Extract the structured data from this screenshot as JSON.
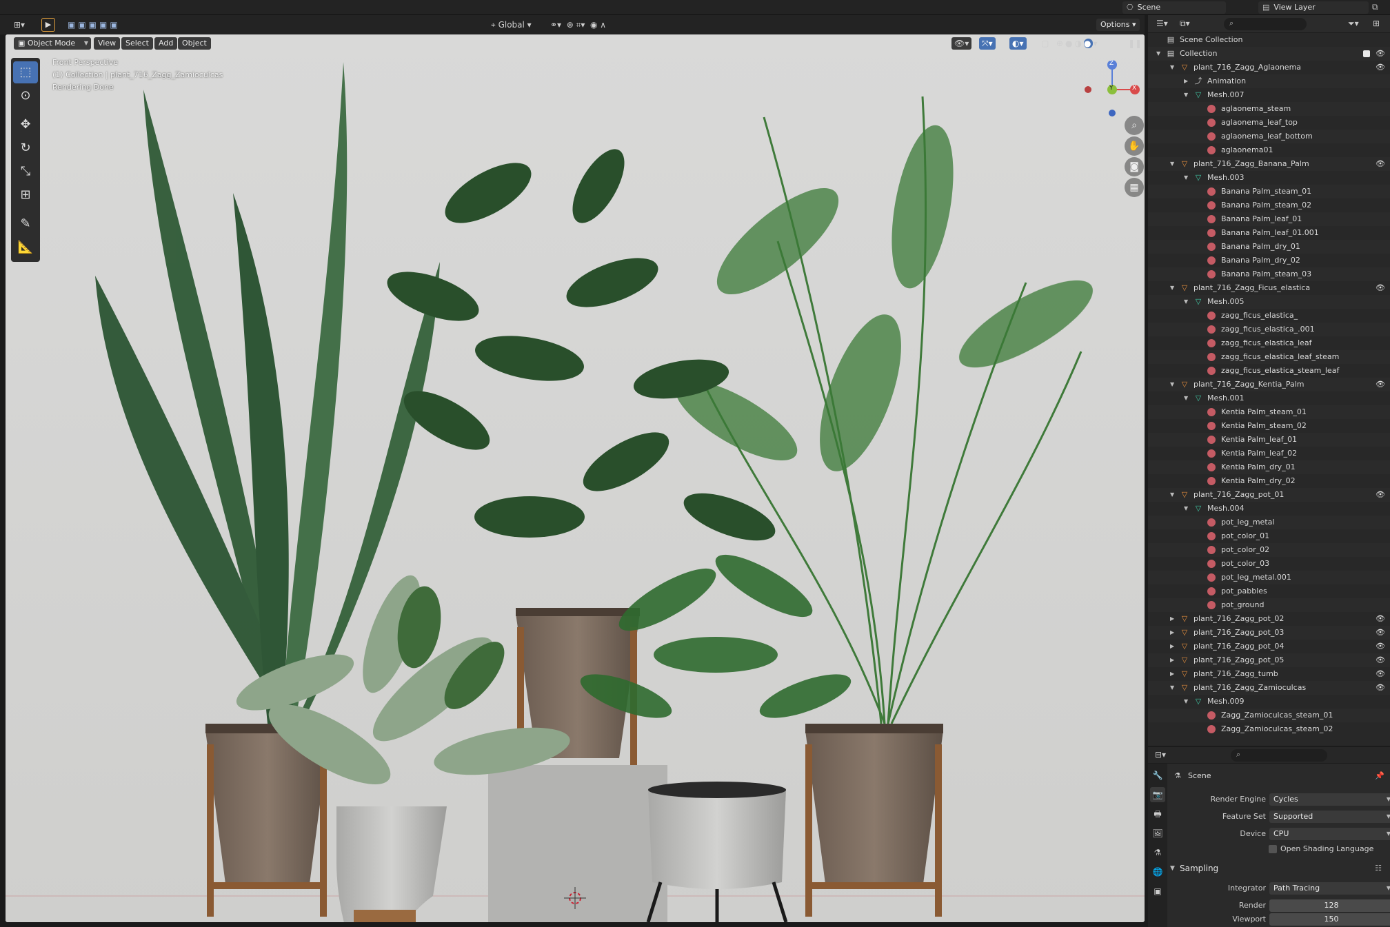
{
  "topbar": {
    "scene_label": "Scene",
    "view_layer_label": "View Layer"
  },
  "viewport_header": {
    "mode": "Object Mode",
    "menus": [
      "View",
      "Select",
      "Add",
      "Object"
    ],
    "transform_orientation": "Global",
    "options_label": "Options"
  },
  "viewport": {
    "overlay_lines": [
      "Front Perspective",
      "(1) Collection | plant_716_Zagg_Zamioculcas",
      "Rendering Done"
    ],
    "gizmo": {
      "z": "Z",
      "y": "Y",
      "x": "X"
    }
  },
  "outliner": {
    "rows": [
      {
        "label": "Scene Collection",
        "type": "scene",
        "depth": 0,
        "arrow": "",
        "eye": false
      },
      {
        "label": "Collection",
        "type": "collection",
        "depth": 0,
        "arrow": "▼",
        "eye": true
      },
      {
        "label": "plant_716_Zagg_Aglaonema",
        "type": "obj",
        "depth": 1,
        "arrow": "▼",
        "eye": true
      },
      {
        "label": "Animation",
        "type": "anim",
        "depth": 2,
        "arrow": "▶",
        "eye": false
      },
      {
        "label": "Mesh.007",
        "type": "mesh",
        "depth": 2,
        "arrow": "▼",
        "eye": false
      },
      {
        "label": "aglaonema_steam",
        "type": "mat",
        "depth": 3,
        "arrow": "",
        "eye": false
      },
      {
        "label": "aglaonema_leaf_top",
        "type": "mat",
        "depth": 3,
        "arrow": "",
        "eye": false
      },
      {
        "label": "aglaonema_leaf_bottom",
        "type": "mat",
        "depth": 3,
        "arrow": "",
        "eye": false
      },
      {
        "label": "aglaonema01",
        "type": "mat",
        "depth": 3,
        "arrow": "",
        "eye": false
      },
      {
        "label": "plant_716_Zagg_Banana_Palm",
        "type": "obj",
        "depth": 1,
        "arrow": "▼",
        "eye": true
      },
      {
        "label": "Mesh.003",
        "type": "mesh",
        "depth": 2,
        "arrow": "▼",
        "eye": false
      },
      {
        "label": "Banana Palm_steam_01",
        "type": "mat",
        "depth": 3,
        "arrow": "",
        "eye": false
      },
      {
        "label": "Banana Palm_steam_02",
        "type": "mat",
        "depth": 3,
        "arrow": "",
        "eye": false
      },
      {
        "label": "Banana Palm_leaf_01",
        "type": "mat",
        "depth": 3,
        "arrow": "",
        "eye": false
      },
      {
        "label": "Banana Palm_leaf_01.001",
        "type": "mat",
        "depth": 3,
        "arrow": "",
        "eye": false
      },
      {
        "label": "Banana Palm_dry_01",
        "type": "mat",
        "depth": 3,
        "arrow": "",
        "eye": false
      },
      {
        "label": "Banana Palm_dry_02",
        "type": "mat",
        "depth": 3,
        "arrow": "",
        "eye": false
      },
      {
        "label": "Banana Palm_steam_03",
        "type": "mat",
        "depth": 3,
        "arrow": "",
        "eye": false
      },
      {
        "label": "plant_716_Zagg_Ficus_elastica",
        "type": "obj",
        "depth": 1,
        "arrow": "▼",
        "eye": true
      },
      {
        "label": "Mesh.005",
        "type": "mesh",
        "depth": 2,
        "arrow": "▼",
        "eye": false
      },
      {
        "label": "zagg_ficus_elastica_",
        "type": "mat",
        "depth": 3,
        "arrow": "",
        "eye": false
      },
      {
        "label": "zagg_ficus_elastica_.001",
        "type": "mat",
        "depth": 3,
        "arrow": "",
        "eye": false
      },
      {
        "label": "zagg_ficus_elastica_leaf",
        "type": "mat",
        "depth": 3,
        "arrow": "",
        "eye": false
      },
      {
        "label": "zagg_ficus_elastica_leaf_steam",
        "type": "mat",
        "depth": 3,
        "arrow": "",
        "eye": false
      },
      {
        "label": "zagg_ficus_elastica_steam_leaf",
        "type": "mat",
        "depth": 3,
        "arrow": "",
        "eye": false
      },
      {
        "label": "plant_716_Zagg_Kentia_Palm",
        "type": "obj",
        "depth": 1,
        "arrow": "▼",
        "eye": true
      },
      {
        "label": "Mesh.001",
        "type": "mesh",
        "depth": 2,
        "arrow": "▼",
        "eye": false
      },
      {
        "label": "Kentia Palm_steam_01",
        "type": "mat",
        "depth": 3,
        "arrow": "",
        "eye": false
      },
      {
        "label": "Kentia Palm_steam_02",
        "type": "mat",
        "depth": 3,
        "arrow": "",
        "eye": false
      },
      {
        "label": "Kentia Palm_leaf_01",
        "type": "mat",
        "depth": 3,
        "arrow": "",
        "eye": false
      },
      {
        "label": "Kentia Palm_leaf_02",
        "type": "mat",
        "depth": 3,
        "arrow": "",
        "eye": false
      },
      {
        "label": "Kentia Palm_dry_01",
        "type": "mat",
        "depth": 3,
        "arrow": "",
        "eye": false
      },
      {
        "label": "Kentia Palm_dry_02",
        "type": "mat",
        "depth": 3,
        "arrow": "",
        "eye": false
      },
      {
        "label": "plant_716_Zagg_pot_01",
        "type": "obj",
        "depth": 1,
        "arrow": "▼",
        "eye": true
      },
      {
        "label": "Mesh.004",
        "type": "mesh",
        "depth": 2,
        "arrow": "▼",
        "eye": false
      },
      {
        "label": "pot_leg_metal",
        "type": "mat",
        "depth": 3,
        "arrow": "",
        "eye": false
      },
      {
        "label": "pot_color_01",
        "type": "mat",
        "depth": 3,
        "arrow": "",
        "eye": false
      },
      {
        "label": "pot_color_02",
        "type": "mat",
        "depth": 3,
        "arrow": "",
        "eye": false
      },
      {
        "label": "pot_color_03",
        "type": "mat",
        "depth": 3,
        "arrow": "",
        "eye": false
      },
      {
        "label": "pot_leg_metal.001",
        "type": "mat",
        "depth": 3,
        "arrow": "",
        "eye": false
      },
      {
        "label": "pot_pabbles",
        "type": "mat",
        "depth": 3,
        "arrow": "",
        "eye": false
      },
      {
        "label": "pot_ground",
        "type": "mat",
        "depth": 3,
        "arrow": "",
        "eye": false
      },
      {
        "label": "plant_716_Zagg_pot_02",
        "type": "obj",
        "depth": 1,
        "arrow": "▶",
        "eye": true
      },
      {
        "label": "plant_716_Zagg_pot_03",
        "type": "obj",
        "depth": 1,
        "arrow": "▶",
        "eye": true
      },
      {
        "label": "plant_716_Zagg_pot_04",
        "type": "obj",
        "depth": 1,
        "arrow": "▶",
        "eye": true
      },
      {
        "label": "plant_716_Zagg_pot_05",
        "type": "obj",
        "depth": 1,
        "arrow": "▶",
        "eye": true
      },
      {
        "label": "plant_716_Zagg_tumb",
        "type": "obj",
        "depth": 1,
        "arrow": "▶",
        "eye": true
      },
      {
        "label": "plant_716_Zagg_Zamioculcas",
        "type": "obj",
        "depth": 1,
        "arrow": "▼",
        "eye": true
      },
      {
        "label": "Mesh.009",
        "type": "mesh",
        "depth": 2,
        "arrow": "▼",
        "eye": false
      },
      {
        "label": "Zagg_Zamioculcas_steam_01",
        "type": "mat",
        "depth": 3,
        "arrow": "",
        "eye": false
      },
      {
        "label": "Zagg_Zamioculcas_steam_02",
        "type": "mat",
        "depth": 3,
        "arrow": "",
        "eye": false
      }
    ]
  },
  "properties": {
    "context_label": "Scene",
    "render_engine_label": "Render Engine",
    "render_engine": "Cycles",
    "feature_set_label": "Feature Set",
    "feature_set": "Supported",
    "device_label": "Device",
    "device": "CPU",
    "osl_label": "Open Shading Language",
    "sampling_label": "Sampling",
    "integrator_label": "Integrator",
    "integrator": "Path Tracing",
    "render_label": "Render",
    "render_samples": "128",
    "viewport_label": "Viewport",
    "viewport_samples": "150"
  },
  "colors": {
    "accent": "#4772b3",
    "object_icon": "#e08b3c",
    "mesh_icon": "#41c9a5",
    "material_icon": "#c55b64"
  }
}
